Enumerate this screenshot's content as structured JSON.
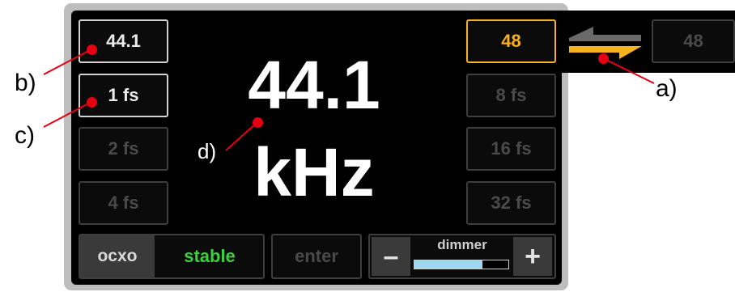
{
  "left_rates": [
    {
      "label": "44.1",
      "state": "lit"
    },
    {
      "label": "1 fs",
      "state": "lit"
    },
    {
      "label": "2 fs",
      "state": "dim"
    },
    {
      "label": "4 fs",
      "state": "dim"
    }
  ],
  "right_rates": [
    {
      "label": "48",
      "state": "selected"
    },
    {
      "label": "8 fs",
      "state": "dim"
    },
    {
      "label": "16 fs",
      "state": "dim"
    },
    {
      "label": "32 fs",
      "state": "dim"
    }
  ],
  "external_rate": {
    "label": "48"
  },
  "display": {
    "value": "44.1",
    "unit": "kHz"
  },
  "ocxo": {
    "label": "ocxo",
    "status": "stable"
  },
  "enter_label": "enter",
  "dimmer": {
    "label": "dimmer",
    "minus": "–",
    "plus": "+",
    "level": 0.72
  },
  "annotations": {
    "a": "a)",
    "b": "b)",
    "c": "c)",
    "d": "d)"
  },
  "colors": {
    "selected": "#f7b21c",
    "stable": "#3ad13a",
    "dimmer_fill": "#9fd7ef",
    "marker": "#e60012"
  }
}
